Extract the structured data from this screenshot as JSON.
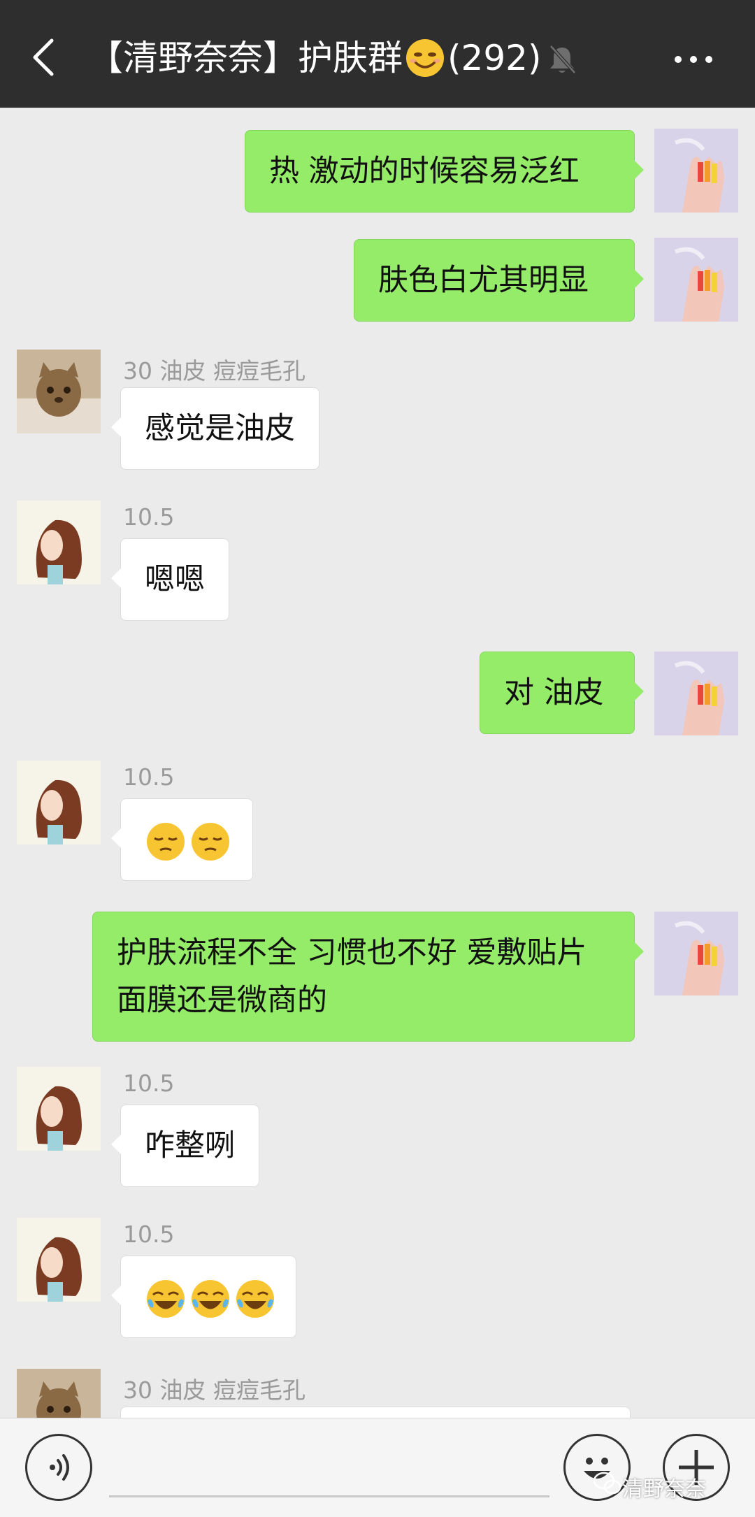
{
  "header": {
    "title_prefix": "【清野奈奈】护肤群",
    "title_emoji": "smiling-face-emoji",
    "member_count": "(292)"
  },
  "messages": [
    {
      "side": "out",
      "text": "热 激动的时候容易泛红"
    },
    {
      "side": "out",
      "text": "肤色白尤其明显"
    },
    {
      "side": "in",
      "sender": "30 油皮 痘痘毛孔",
      "text": "感觉是油皮"
    },
    {
      "side": "in",
      "sender": "10.5",
      "text": "嗯嗯"
    },
    {
      "side": "out",
      "text": "对 油皮"
    },
    {
      "side": "in",
      "sender": "10.5",
      "emoji": "pensive-face-emoji",
      "emoji_count": 2
    },
    {
      "side": "out",
      "text": "护肤流程不全 习惯也不好 爱敷贴片面膜还是微商的"
    },
    {
      "side": "in",
      "sender": "10.5",
      "text": "咋整咧"
    },
    {
      "side": "in",
      "sender": "10.5",
      "emoji": "tears-of-joy-emoji",
      "emoji_count": 3
    },
    {
      "side": "in",
      "sender": "30 油皮 痘痘毛孔",
      "text": ""
    }
  ],
  "watermark": "清野奈奈",
  "colors": {
    "header_bg": "#2e2e2e",
    "chat_bg": "#ebebeb",
    "outgoing_bubble": "#95ec69",
    "incoming_bubble": "#ffffff"
  }
}
